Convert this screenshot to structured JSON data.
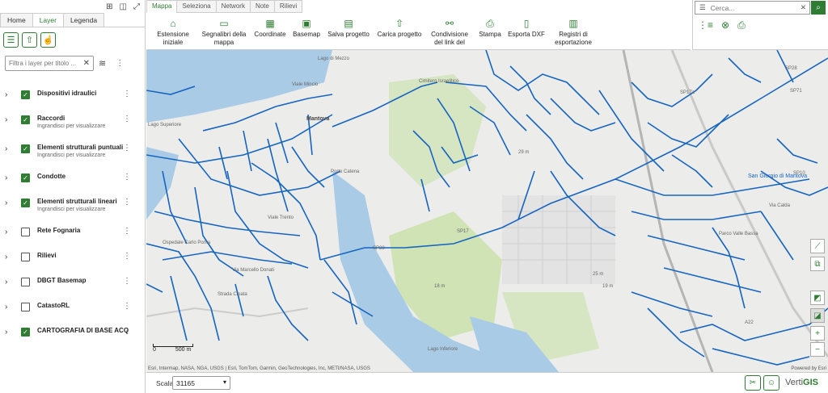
{
  "left_panel": {
    "tabs": [
      "Home",
      "Layer",
      "Legenda"
    ],
    "active_tab": "Layer",
    "filter_placeholder": "Filtra i layer per titolo ...",
    "layers": [
      {
        "name": "Dispositivi idraulici",
        "sub": "",
        "checked": true
      },
      {
        "name": "Raccordi",
        "sub": "Ingrandisci per visualizzare",
        "checked": true
      },
      {
        "name": "Elementi strutturali puntuali",
        "sub": "Ingrandisci per visualizzare",
        "checked": true
      },
      {
        "name": "Condotte",
        "sub": "",
        "checked": true
      },
      {
        "name": "Elementi strutturali lineari",
        "sub": "Ingrandisci per visualizzare",
        "checked": true
      },
      {
        "name": "Rete Fognaria",
        "sub": "",
        "checked": false
      },
      {
        "name": "Rilievi",
        "sub": "",
        "checked": false
      },
      {
        "name": "DBGT Basemap",
        "sub": "",
        "checked": false
      },
      {
        "name": "CatastoRL",
        "sub": "",
        "checked": false
      },
      {
        "name": "CARTOGRAFIA DI BASE ACQ",
        "sub": "",
        "checked": true
      }
    ]
  },
  "toolbar": {
    "tabs": [
      "Mappa",
      "Seleziona",
      "Network",
      "Note",
      "Rilievi"
    ],
    "active_tab": "Mappa",
    "buttons": [
      {
        "label": "Estensione iniziale",
        "icon": "home-icon"
      },
      {
        "label": "Segnalibri della mappa",
        "icon": "book-icon"
      },
      {
        "label": "Coordinate",
        "icon": "grid-icon"
      },
      {
        "label": "Basemap",
        "icon": "basemap-icon"
      },
      {
        "label": "Salva progetto",
        "icon": "save-icon"
      },
      {
        "label": "Carica progetto",
        "icon": "upload-icon"
      },
      {
        "label": "Condivisione del link del",
        "icon": "share-icon"
      },
      {
        "label": "Stampa",
        "icon": "printer-icon"
      },
      {
        "label": "Esporta DXF",
        "icon": "export-icon"
      },
      {
        "label": "Registri di esportazione",
        "icon": "log-icon"
      }
    ]
  },
  "search": {
    "placeholder": "Cerca..."
  },
  "map": {
    "labels": [
      "Lago di Mezzo",
      "Viale Mincio",
      "Mantova",
      "Lago Superiore",
      "Porto Catena",
      "Viale Trento",
      "Ospedale Carlo Poma",
      "Via Marcello Donati",
      "Strada Cipata",
      "Lago Inferiore",
      "San Giorgio di Mantova",
      "Cimitero Israelitico",
      "Parco Valle Bassa",
      "Via Calda",
      "29 m",
      "19 m",
      "25 m",
      "18 m",
      "SP28",
      "SP71",
      "A22",
      "SP10",
      "SP17",
      "SP28",
      "SP17a"
    ],
    "scalebar": {
      "zero": "0",
      "dist": "500 m"
    },
    "attribution": "Esri, Intermap, NASA, NGA, USGS | Esri, TomTom, Garmin, GeoTechnologies, Inc, METI/NASA, USGS",
    "powered": "Powered by Esri"
  },
  "bottom": {
    "scale_label": "Scala",
    "scale_value": "31165",
    "brand_a": "Verti",
    "brand_b": "GIS"
  },
  "colors": {
    "accent": "#2e7d32",
    "network": "#1565c0",
    "water": "#a9cbe6",
    "park": "#cfe3b5"
  }
}
